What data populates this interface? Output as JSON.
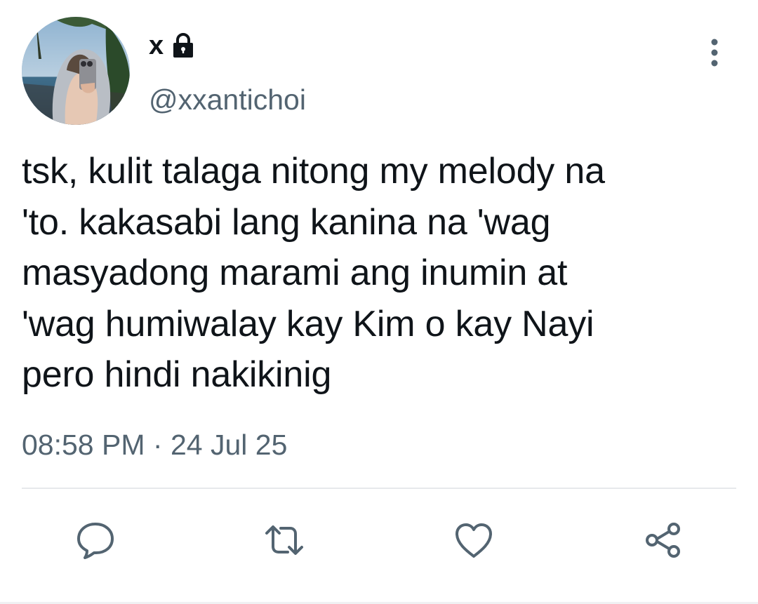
{
  "author": {
    "display_name": "x",
    "handle": "@xxantichoi",
    "protected_icon": "lock-icon",
    "avatar_description": "avatar"
  },
  "tweet": {
    "text": "tsk, kulit talaga nitong my melody na\n'to. kakasabi lang kanina na 'wag\nmasyadong marami ang inumin at\n'wag humiwalay kay Kim o kay Nayi\npero hindi nakikinig",
    "time": "08:58 PM",
    "separator": "·",
    "date": "24 Jul 25"
  },
  "actions": {
    "reply_icon": "speech-bubble-icon",
    "retweet_icon": "retweet-icon",
    "like_icon": "heart-icon",
    "share_icon": "share-icon",
    "more_icon": "vertical-ellipsis-icon"
  },
  "colors": {
    "text_primary": "#0f1419",
    "text_secondary": "#536471",
    "icon": "#536471",
    "divider": "#e7e9ec",
    "background": "#ffffff"
  }
}
